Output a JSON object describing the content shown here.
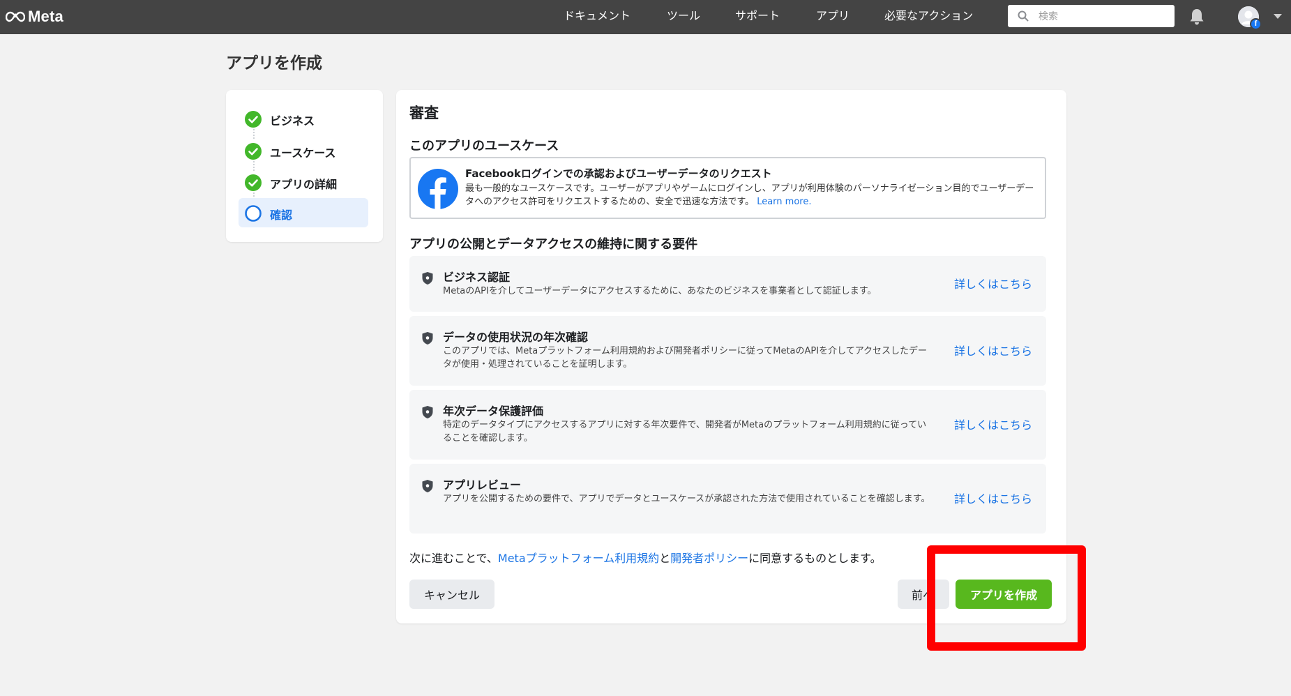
{
  "topbar": {
    "logo_text": "Meta",
    "nav": [
      "ドキュメント",
      "ツール",
      "サポート",
      "アプリ",
      "必要なアクション"
    ],
    "search_placeholder": "検索",
    "avatar_badge": "f"
  },
  "page": {
    "title": "アプリを作成"
  },
  "steps": [
    {
      "label": "ビジネス",
      "status": "complete"
    },
    {
      "label": "ユースケース",
      "status": "complete"
    },
    {
      "label": "アプリの詳細",
      "status": "complete"
    },
    {
      "label": "確認",
      "status": "current"
    }
  ],
  "review": {
    "title": "審査",
    "usecase_heading": "このアプリのユースケース",
    "usecase": {
      "title": "Facebookログインでの承認およびユーザーデータのリクエスト",
      "desc": "最も一般的なユースケースです。ユーザーがアプリやゲームにログインし、アプリが利用体験のパーソナライゼーション目的でユーザーデータへのアクセス許可をリクエストするための、安全で迅速な方法です。",
      "learn_more": "Learn more."
    },
    "requirements_heading": "アプリの公開とデータアクセスの維持に関する要件",
    "requirements": [
      {
        "title": "ビジネス認証",
        "desc": "MetaのAPIを介してユーザーデータにアクセスするために、あなたのビジネスを事業者として認証します。",
        "link": "詳しくはこちら"
      },
      {
        "title": "データの使用状況の年次確認",
        "desc": "このアプリでは、Metaプラットフォーム利用規約および開発者ポリシーに従ってMetaのAPIを介してアクセスしたデータが使用・処理されていることを証明します。",
        "link": "詳しくはこちら"
      },
      {
        "title": "年次データ保護評価",
        "desc": "特定のデータタイプにアクセスするアプリに対する年次要件で、開発者がMetaのプラットフォーム利用規約に従っていることを確認します。",
        "link": "詳しくはこちら"
      },
      {
        "title": "アプリレビュー",
        "desc": "アプリを公開するための要件で、アプリでデータとユースケースが承認された方法で使用されていることを確認します。",
        "link": "詳しくはこちら"
      }
    ],
    "consent": {
      "prefix": "次に進むことで、",
      "terms_link": "Metaプラットフォーム利用規約",
      "and": "と",
      "policy_link": "開発者ポリシー",
      "suffix": "に同意するものとします。"
    }
  },
  "buttons": {
    "cancel": "キャンセル",
    "previous": "前へ",
    "create": "アプリを作成"
  },
  "colors": {
    "topbar": "#444444",
    "accent_blue": "#1b74e4",
    "step_complete": "#42b72a",
    "create_button": "#58b81e",
    "highlight": "#ff0000"
  },
  "icons": {
    "logo": "meta-infinity-icon",
    "search": "search-icon",
    "bell": "bell-icon",
    "step_complete": "check-circle-icon",
    "step_current": "empty-circle-icon",
    "usecase": "facebook-icon",
    "requirement": "shield-icon"
  }
}
